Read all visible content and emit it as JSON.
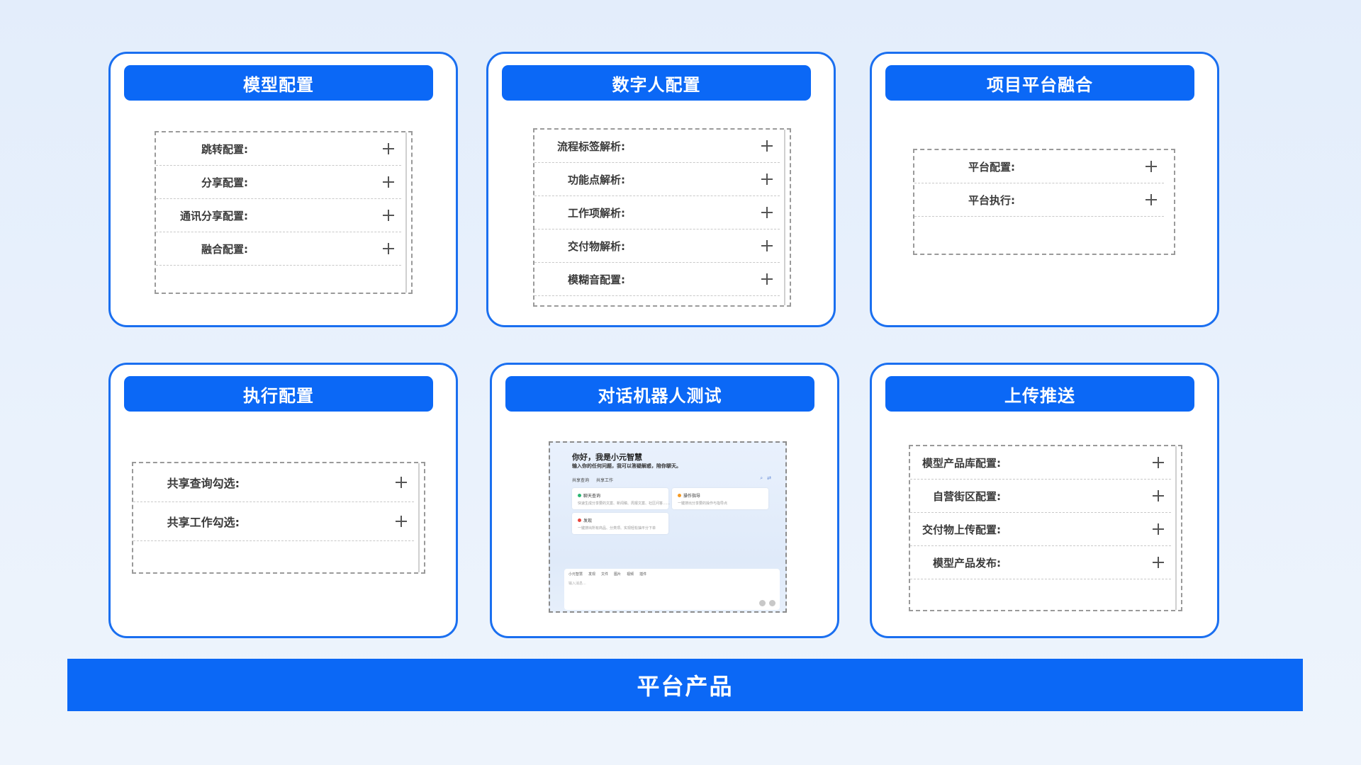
{
  "cards": [
    {
      "title": "模型配置",
      "items": [
        "跳转配置:",
        "分享配置:",
        "通讯分享配置:",
        "融合配置:"
      ]
    },
    {
      "title": "数字人配置",
      "items": [
        "流程标签解析:",
        "功能点解析:",
        "工作项解析:",
        "交付物解析:",
        "模糊音配置:"
      ]
    },
    {
      "title": "项目平台融合",
      "items": [
        "平台配置:",
        "平台执行:"
      ]
    },
    {
      "title": "执行配置",
      "items": [
        "共享查询勾选:",
        "共享工作勾选:"
      ]
    },
    {
      "title": "对话机器人测试",
      "chat": {
        "greeting": "你好，我是小元智慧",
        "subtitle": "输入你的任何问题，我可以答疑解惑，陪你聊天。",
        "tabs": [
          "共享查询",
          "共享工作"
        ],
        "cards": [
          {
            "title": "聊天查询",
            "desc": "快速生成分享要的文案、新闻稿、周报文案、社区问答……",
            "color": "#2bb673"
          },
          {
            "title": "操作指导",
            "desc": "一键搜出分享要的操作与指导点",
            "color": "#f59a23"
          },
          {
            "title": "发现",
            "desc": "一键搜出所有商品、分类项、实现轻松抽平分下单",
            "color": "#e8453c"
          }
        ],
        "toolbar": [
          "小元智慧",
          "发现",
          "文件",
          "图片",
          "视频",
          "插件"
        ],
        "placeholder": "输入消息..."
      }
    },
    {
      "title": "上传推送",
      "items": [
        "模型产品库配置:",
        "自营街区配置:",
        "交付物上传配置:",
        "模型产品发布:"
      ]
    }
  ],
  "footer": {
    "label": "平台产品"
  },
  "colors": {
    "accent": "#0b68f6",
    "border": "#1a6ff0"
  }
}
